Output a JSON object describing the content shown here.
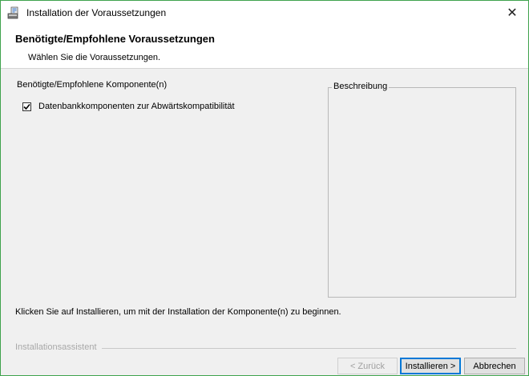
{
  "window": {
    "title": "Installation der Voraussetzungen",
    "close_glyph": "✕",
    "app_icon": "installer-icon"
  },
  "header": {
    "title": "Benötigte/Empfohlene Voraussetzungen",
    "subtitle": "Wählen Sie die Voraussetzungen."
  },
  "components": {
    "label": "Benötigte/Empfohlene Komponente(n)",
    "items": [
      {
        "label": "Datenbankkomponenten zur Abwärtskompatibilität",
        "checked": true
      }
    ]
  },
  "description": {
    "legend": "Beschreibung",
    "text": ""
  },
  "footer": {
    "instruction": "Klicken Sie auf Installieren, um mit der Installation der Komponente(n) zu beginnen.",
    "assistant_label": "Installationsassistent"
  },
  "buttons": {
    "back": "< Zurück",
    "install": "Installieren >",
    "cancel": "Abbrechen"
  },
  "colors": {
    "window_border": "#3fa34d",
    "background": "#f0f0f0",
    "default_button_border": "#0078d7"
  }
}
